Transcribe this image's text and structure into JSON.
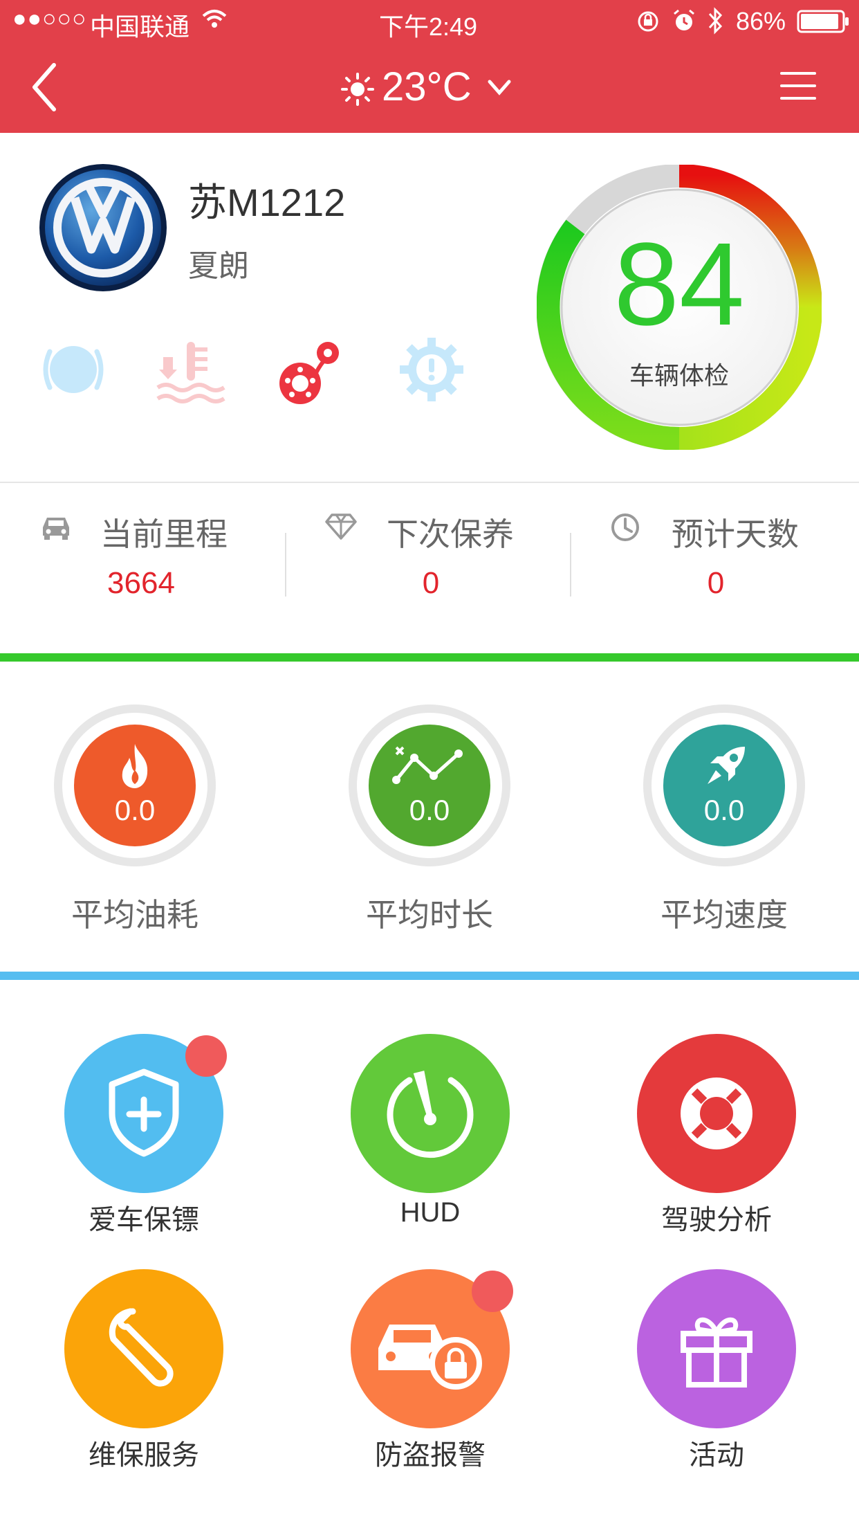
{
  "status_bar": {
    "signal": "●●○○○",
    "carrier": "中国联通",
    "time": "下午2:49",
    "battery": "86%"
  },
  "header": {
    "temperature": "23°C",
    "bg_color": "#e2404a"
  },
  "vehicle": {
    "plate": "苏M1212",
    "model": "夏朗"
  },
  "warning_icons": [
    "tire-pressure-icon",
    "coolant-temp-icon",
    "brake-icon",
    "engine-fault-icon"
  ],
  "health": {
    "score": "84",
    "label": "车辆体检"
  },
  "stats": [
    {
      "label": "当前里程",
      "value": "3664",
      "icon": "car-icon"
    },
    {
      "label": "下次保养",
      "value": "0",
      "icon": "diamond-icon"
    },
    {
      "label": "预计天数",
      "value": "0",
      "icon": "clock-icon"
    }
  ],
  "averages": [
    {
      "label": "平均油耗",
      "value": "0.0",
      "icon": "flame-icon",
      "color": "#ee5a2b"
    },
    {
      "label": "平均时长",
      "value": "0.0",
      "icon": "trend-icon",
      "color": "#52a82f"
    },
    {
      "label": "平均速度",
      "value": "0.0",
      "icon": "rocket-icon",
      "color": "#2fa39a"
    }
  ],
  "services": [
    {
      "label": "爱车保镖",
      "icon": "shield-plus-icon",
      "color": "#52bdf0",
      "badge": true
    },
    {
      "label": "HUD",
      "icon": "speedometer-icon",
      "color": "#62c93a",
      "badge": false
    },
    {
      "label": "驾驶分析",
      "icon": "lifebuoy-icon",
      "color": "#e43a3c",
      "badge": false
    },
    {
      "label": "维保服务",
      "icon": "wrench-icon",
      "color": "#fba409",
      "badge": false
    },
    {
      "label": "防盗报警",
      "icon": "car-lock-icon",
      "color": "#fb7c44",
      "badge": true
    },
    {
      "label": "活动",
      "icon": "gift-icon",
      "color": "#bb62e0",
      "badge": false
    }
  ]
}
